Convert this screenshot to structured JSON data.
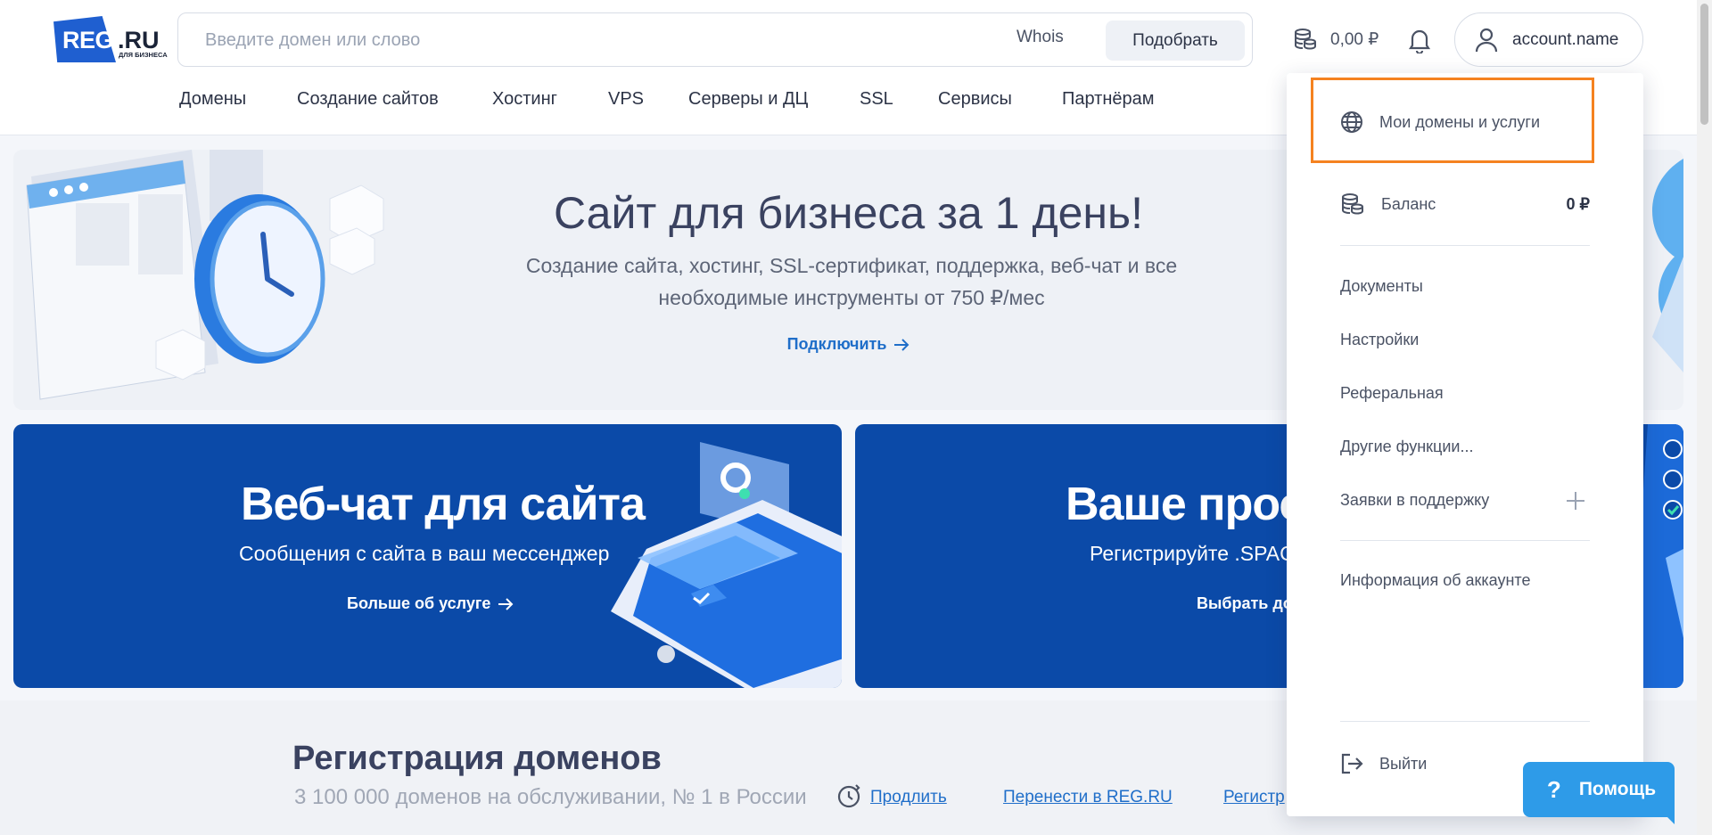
{
  "header": {
    "logo": {
      "reg": "REG",
      "ru": ".RU",
      "sub": "ДЛЯ БИЗНЕСА"
    },
    "search": {
      "placeholder": "Введите домен или слово",
      "whois": "Whois",
      "button": "Подобрать"
    },
    "balance": "0,00 ₽",
    "account": "account.name"
  },
  "nav": [
    "Домены",
    "Создание сайтов",
    "Хостинг",
    "VPS",
    "Серверы и ДЦ",
    "SSL",
    "Сервисы",
    "Партнёрам"
  ],
  "hero": {
    "title": "Сайт для бизнеса за 1 день!",
    "subtitle_line1": "Создание сайта, хостинг, SSL-сертификат, поддержка, веб-чат и все",
    "subtitle_line2": "необходимые инструменты от 750 ₽/мес",
    "link": "Подключить"
  },
  "cards": [
    {
      "title": "Веб-чат для сайта",
      "subtitle": "Сообщения с сайта в ваш мессенджер",
      "link": "Больше об услуге"
    },
    {
      "title": "Ваше прос",
      "subtitle": "Регистрируйте .SPAC",
      "link": "Выбрать до"
    }
  ],
  "domains": {
    "title": "Регистрация доменов",
    "subtitle": "3 100 000 доменов на обслуживании, № 1 в России",
    "links": [
      "Продлить",
      "Перенести в REG.RU",
      "Регистр"
    ]
  },
  "dropdown": {
    "my_domains": "Мои домены и услуги",
    "balance_label": "Баланс",
    "balance_value": "0 ₽",
    "documents": "Документы",
    "settings": "Настройки",
    "referral": "Реферальная",
    "other": "Другие функции...",
    "support": "Заявки в поддержку",
    "account_info": "Информация об аккаунте",
    "logout": "Выйти"
  },
  "help": {
    "label": "Помощь",
    "q": "?"
  },
  "colors": {
    "brand": "#1f5fd0",
    "link": "#1f6ec9",
    "card": "#0b4aa8",
    "highlight": "#f58220",
    "help": "#2e9be8"
  }
}
